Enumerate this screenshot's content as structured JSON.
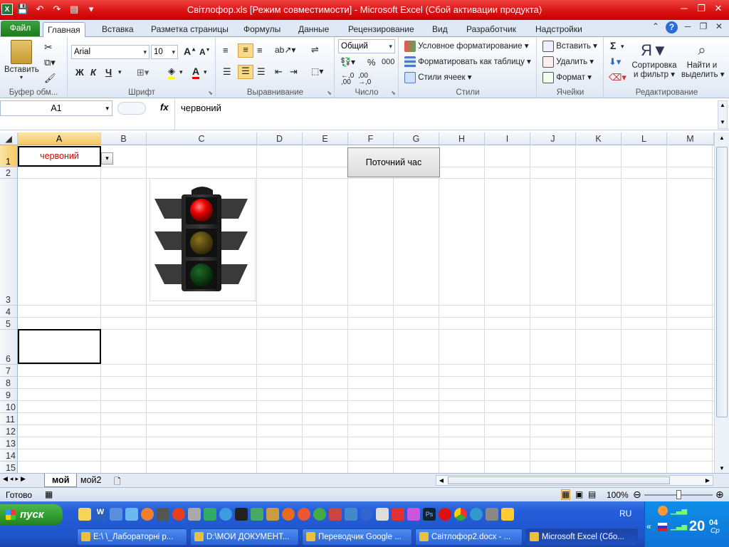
{
  "titlebar": {
    "title": "Світлофор.xls  [Режим совместимости]  -  Microsoft Excel (Сбой активации продукта)"
  },
  "tabs": {
    "file": "Файл",
    "items": [
      "Главная",
      "Вставка",
      "Разметка страницы",
      "Формулы",
      "Данные",
      "Рецензирование",
      "Вид",
      "Разработчик",
      "Надстройки"
    ]
  },
  "ribbon": {
    "clipboard": {
      "paste": "Вставить",
      "label": "Буфер обм..."
    },
    "font": {
      "name": "Arial",
      "size": "10",
      "bold": "Ж",
      "italic": "К",
      "underline": "Ч",
      "label": "Шрифт"
    },
    "alignment": {
      "label": "Выравнивание"
    },
    "number": {
      "format": "Общий",
      "percent": "%",
      "thousands": "000",
      "label": "Число"
    },
    "styles": {
      "conditional": "Условное форматирование",
      "table": "Форматировать как таблицу",
      "cell": "Стили ячеек",
      "label": "Стили"
    },
    "cells": {
      "insert": "Вставить",
      "delete": "Удалить",
      "format": "Формат",
      "label": "Ячейки"
    },
    "editing": {
      "sum": "Σ",
      "sort": "Сортировка\nи фильтр",
      "sort1": "Сортировка",
      "sort2": "и фильтр",
      "find1": "Найти и",
      "find2": "выделить",
      "label": "Редактирование"
    }
  },
  "formulabar": {
    "namebox": "A1",
    "fx": "fx",
    "value": "червоний"
  },
  "sheet": {
    "columns": [
      "A",
      "B",
      "C",
      "D",
      "E",
      "F",
      "G",
      "H",
      "I",
      "J",
      "K",
      "L",
      "M"
    ],
    "rows": [
      "1",
      "2",
      "3",
      "4",
      "5",
      "6",
      "7",
      "8",
      "9",
      "10",
      "11",
      "12",
      "13",
      "14",
      "15"
    ],
    "a1_value": "червоний",
    "button_label": "Поточний час"
  },
  "sheettabs": {
    "tabs": [
      "мой",
      "мой2"
    ]
  },
  "status": {
    "ready": "Готово",
    "zoom": "100%"
  },
  "taskbar": {
    "start": "пуск",
    "tasks": [
      "E:\\ \\_Лабораторні р...",
      "D:\\МОИ ДОКУМЕНТ...",
      "Переводчик Google ...",
      "Світлофор2.docx - ...",
      "Microsoft Excel (Сбо..."
    ],
    "lang": "RU",
    "clock": "20",
    "clock_small": "04",
    "day": "Ср"
  },
  "colors": {
    "title_red": "#d81010",
    "taskbar_blue": "#245edb",
    "a1_text": "#dd0000"
  }
}
